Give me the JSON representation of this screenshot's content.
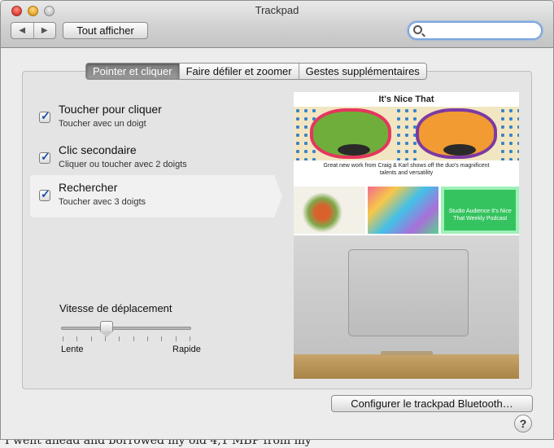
{
  "window": {
    "title": "Trackpad"
  },
  "toolbar": {
    "back_icon": "back-arrow-icon",
    "forward_icon": "forward-arrow-icon",
    "show_all_label": "Tout afficher",
    "search_placeholder": ""
  },
  "tabs": [
    {
      "label": "Pointer et cliquer",
      "active": true
    },
    {
      "label": "Faire défiler et zoomer",
      "active": false
    },
    {
      "label": "Gestes supplémentaires",
      "active": false
    }
  ],
  "options": [
    {
      "title": "Toucher pour cliquer",
      "subtitle": "Toucher avec un doigt",
      "checked": true,
      "selected": false
    },
    {
      "title": "Clic secondaire",
      "subtitle": "Cliquer ou toucher avec 2 doigts",
      "checked": true,
      "selected": false
    },
    {
      "title": "Rechercher",
      "subtitle": "Toucher avec 3 doigts",
      "checked": true,
      "selected": true
    }
  ],
  "tracking_speed": {
    "label": "Vitesse de déplacement",
    "min_label": "Lente",
    "max_label": "Rapide",
    "value_fraction": 0.35,
    "tick_count": 10
  },
  "preview": {
    "site_title": "It's Nice That",
    "caption": "Great new work from Craig & Karl shows off the duo's magnificent talents and versatility",
    "card_text": "Studio Audience It's Nice That Weekly Podcast"
  },
  "footer": {
    "bluetooth_button_label": "Configurer le trackpad Bluetooth…",
    "help_label": "?"
  },
  "background": {
    "bottom_text": "I went ahead and borrowed my old 4,1 MBP from my"
  },
  "colors": {
    "accent_blue": "#1d4fa7",
    "active_tab": "#8a8a8a",
    "search_focus": "#7aa7e0"
  }
}
